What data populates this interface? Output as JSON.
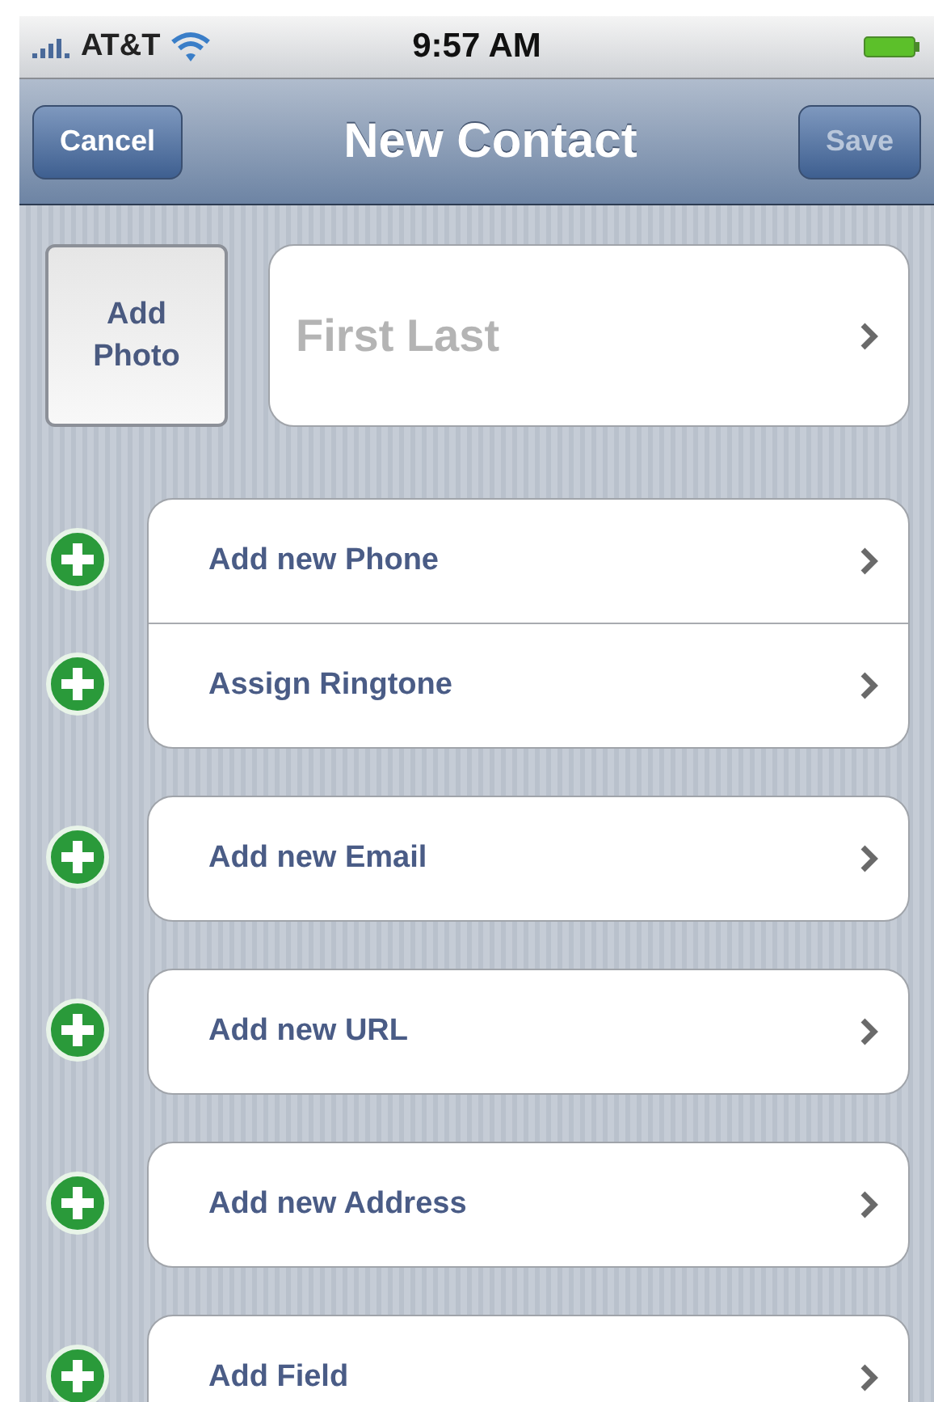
{
  "status_bar": {
    "carrier": "AT&T",
    "time": "9:57 AM"
  },
  "nav_bar": {
    "cancel": {
      "label": "Cancel",
      "disabled": false
    },
    "title": "New Contact",
    "save": {
      "label": "Save",
      "disabled": true
    }
  },
  "photo_button": {
    "label": "Add Photo"
  },
  "name_field": {
    "placeholder": "First Last"
  },
  "groups": [
    {
      "rows": [
        {
          "label": "Add new Phone"
        },
        {
          "label": "Assign Ringtone"
        }
      ]
    },
    {
      "rows": [
        {
          "label": "Add new Email"
        }
      ]
    },
    {
      "rows": [
        {
          "label": "Add new URL"
        }
      ]
    },
    {
      "rows": [
        {
          "label": "Add new Address"
        }
      ]
    },
    {
      "rows": [
        {
          "label": "Add Field"
        }
      ]
    }
  ]
}
